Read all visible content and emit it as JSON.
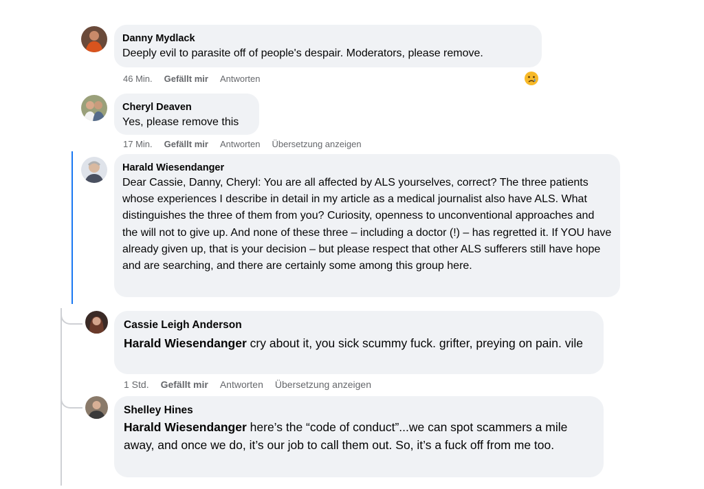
{
  "comments": [
    {
      "author": "Danny Mydlack",
      "text": "Deeply evil to parasite off of people's despair. Moderators, please remove.",
      "time": "46 Min.",
      "like": "Gefällt mir",
      "reply": "Antworten",
      "reaction": "😢",
      "avatar_icon": "avatar-photo"
    },
    {
      "author": "Cheryl Deaven",
      "text": "Yes, please remove this",
      "time": "17 Min.",
      "like": "Gefällt mir",
      "reply": "Antworten",
      "translate": "Übersetzung anzeigen",
      "avatar_icon": "avatar-photo"
    },
    {
      "author": "Harald Wiesendanger",
      "text": "Dear Cassie, Danny, Cheryl: You are all affected by ALS yourselves, correct? The three patients whose experiences I describe in detail in my article as a medical journalist also have ALS. What distinguishes the three of them from you? Curiosity, openness to unconventional approaches and the will not to give up. And none of these three – including a doctor (!) – has regretted it. If YOU have already given up, that is your decision – but please respect that other ALS sufferers still have hope and are searching, and there are certainly some among this group here.",
      "avatar_icon": "avatar-photo"
    },
    {
      "author": "Cassie Leigh Anderson",
      "mention": "Harald Wiesendanger",
      "text": " cry about it, you sick scummy fuck. grifter, preying on pain. vile",
      "time": "1 Std.",
      "like": "Gefällt mir",
      "reply": "Antworten",
      "translate": "Übersetzung anzeigen",
      "avatar_icon": "avatar-photo"
    },
    {
      "author": "Shelley Hines",
      "mention": "Harald Wiesendanger",
      "text": " here’s the “code of conduct”...we can spot scammers a mile away, and once we do, it’s our job to call them out. So, it’s a fuck off from me too.",
      "avatar_icon": "avatar-photo"
    }
  ],
  "colors": {
    "bubble": "#f0f2f5",
    "meta_text": "#65676b",
    "thread_line": "#ced0d4",
    "accent_line": "#1877f2"
  }
}
